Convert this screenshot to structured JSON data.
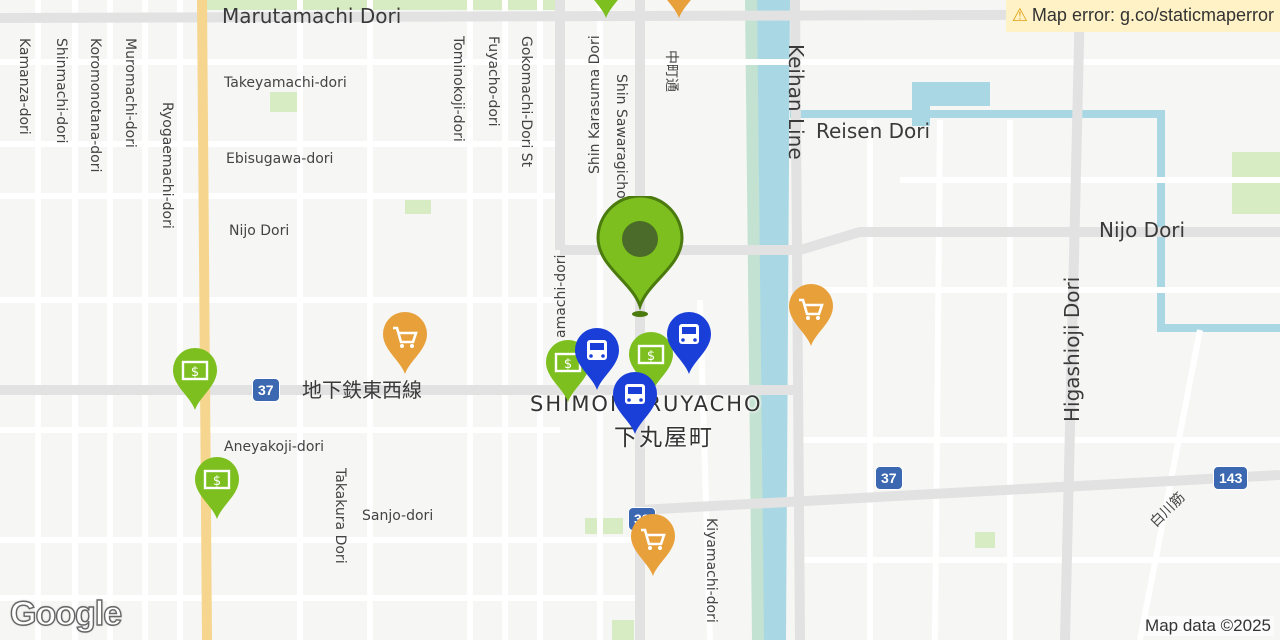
{
  "banner": {
    "text": "Map error: g.co/staticmaperror",
    "icon": "warning-icon"
  },
  "credit": "Map data ©2025",
  "logo": "Google",
  "streets": {
    "marutamachi": "Marutamachi Dori",
    "takeyamachi": "Takeyamachi-dori",
    "ebisugawa": "Ebisugawa-dori",
    "nijo_w": "Nijo Dori",
    "nijo_e": "Nijo Dori",
    "reisen": "Reisen Dori",
    "keihan": "Keihan Line",
    "higashioji": "Higashioji Dori",
    "subway": "地下鉄東西線",
    "aneyakoji": "Aneyakoji-dori",
    "sanjo": "Sanjo-dori",
    "takakura": "Takakura Dori",
    "kiyamachi": "Kiyamachi-dori",
    "kamanza": "Kamanza-dori",
    "shinmachi": "Shinmachi-dori",
    "koromonotana": "Koromonotana-dori",
    "muromachi": "Muromachi-dori",
    "ryogaemachi": "Ryogaemachi-dori",
    "tominokoji": "Tominokoji-dori",
    "fuyacho": "Fuyacho-dori",
    "gokomachi": "Gokomachi-Dori St",
    "shin_karasuma": "Shin Karasuma Dori",
    "shin_sawaragicho": "Shin Sawaragicho",
    "nakamachi": "中町通",
    "teramachi": "amachi-dori",
    "shirakawa": "白川筋"
  },
  "district": {
    "romaji": "SHIMOMARUYACHO",
    "kanji": "下丸屋町"
  },
  "route_shields": {
    "r37_west": "37",
    "r37_east": "37",
    "r143": "143",
    "r33": "33"
  },
  "colors": {
    "selected_pin": "#7cbf1e",
    "bank_pin": "#7cbf1e",
    "bus_pin": "#1a3fd9",
    "shop_pin": "#e8a03b",
    "shield": "#3b68b0",
    "water": "#a9d8e4",
    "major_road": "#f6d68f"
  },
  "markers": [
    {
      "name": "selected-location-pin",
      "icon": "location-pin-icon"
    },
    {
      "name": "bank-pin",
      "icon": "bank-note-icon"
    },
    {
      "name": "bus-stop-pin",
      "icon": "bus-icon"
    },
    {
      "name": "shopping-pin",
      "icon": "shopping-cart-icon"
    }
  ]
}
